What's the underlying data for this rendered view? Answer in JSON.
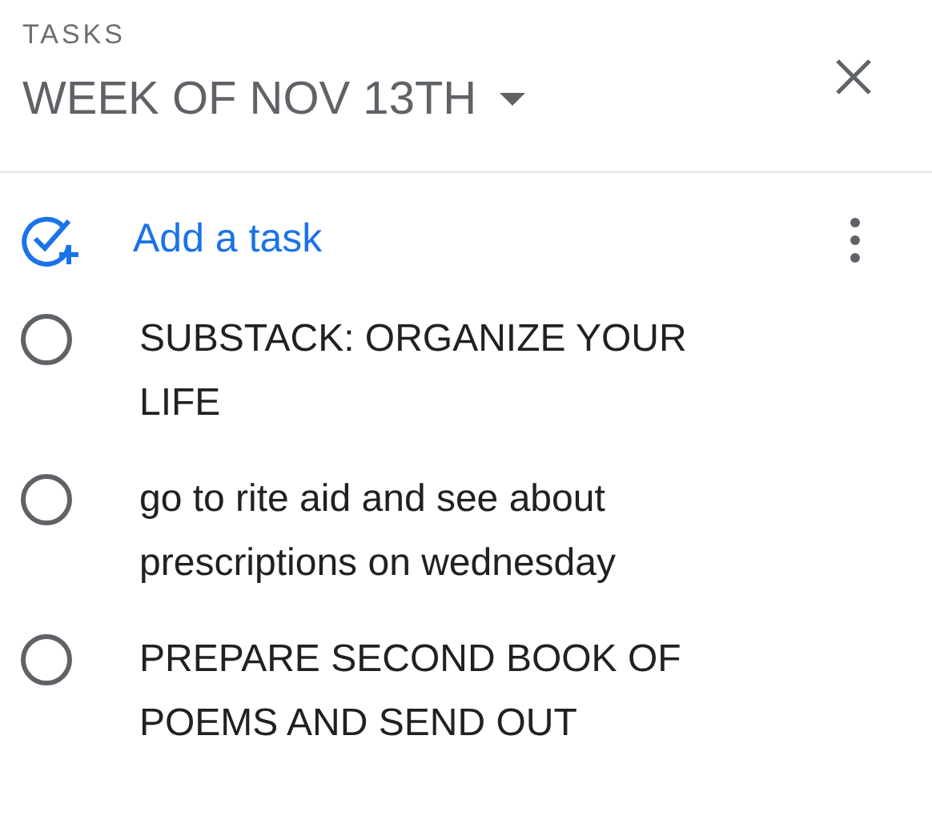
{
  "header": {
    "label": "TASKS",
    "list_title": "WEEK OF NOV 13TH"
  },
  "add_task": {
    "label": "Add a task"
  },
  "tasks": [
    {
      "title": "SUBSTACK: ORGANIZE YOUR LIFE",
      "checked": false
    },
    {
      "title": "go to rite aid and see about prescriptions on wednesday",
      "checked": false
    },
    {
      "title": "PREPARE SECOND BOOK OF POEMS AND SEND OUT",
      "checked": false
    }
  ]
}
